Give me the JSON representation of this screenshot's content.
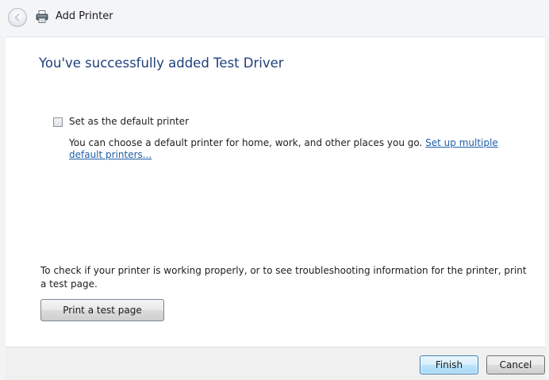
{
  "window": {
    "title": "Add Printer"
  },
  "content": {
    "heading": "You've successfully added Test Driver",
    "default_printer": {
      "checkbox_label": "Set as the default printer",
      "checked": false,
      "description": "You can choose a default printer for home, work, and other places you go.",
      "link_text": "Set up multiple default printers..."
    },
    "test_info": "To check if your printer is working properly, or to see troubleshooting information for the printer, print a test page.",
    "test_button_label": "Print a test page"
  },
  "footer": {
    "finish_label": "Finish",
    "cancel_label": "Cancel"
  },
  "icons": {
    "back": "back-arrow-icon",
    "printer": "printer-icon"
  },
  "colors": {
    "heading": "#1f3f7a",
    "link": "#1f5ea8",
    "finish_border": "#3c7fb1"
  }
}
